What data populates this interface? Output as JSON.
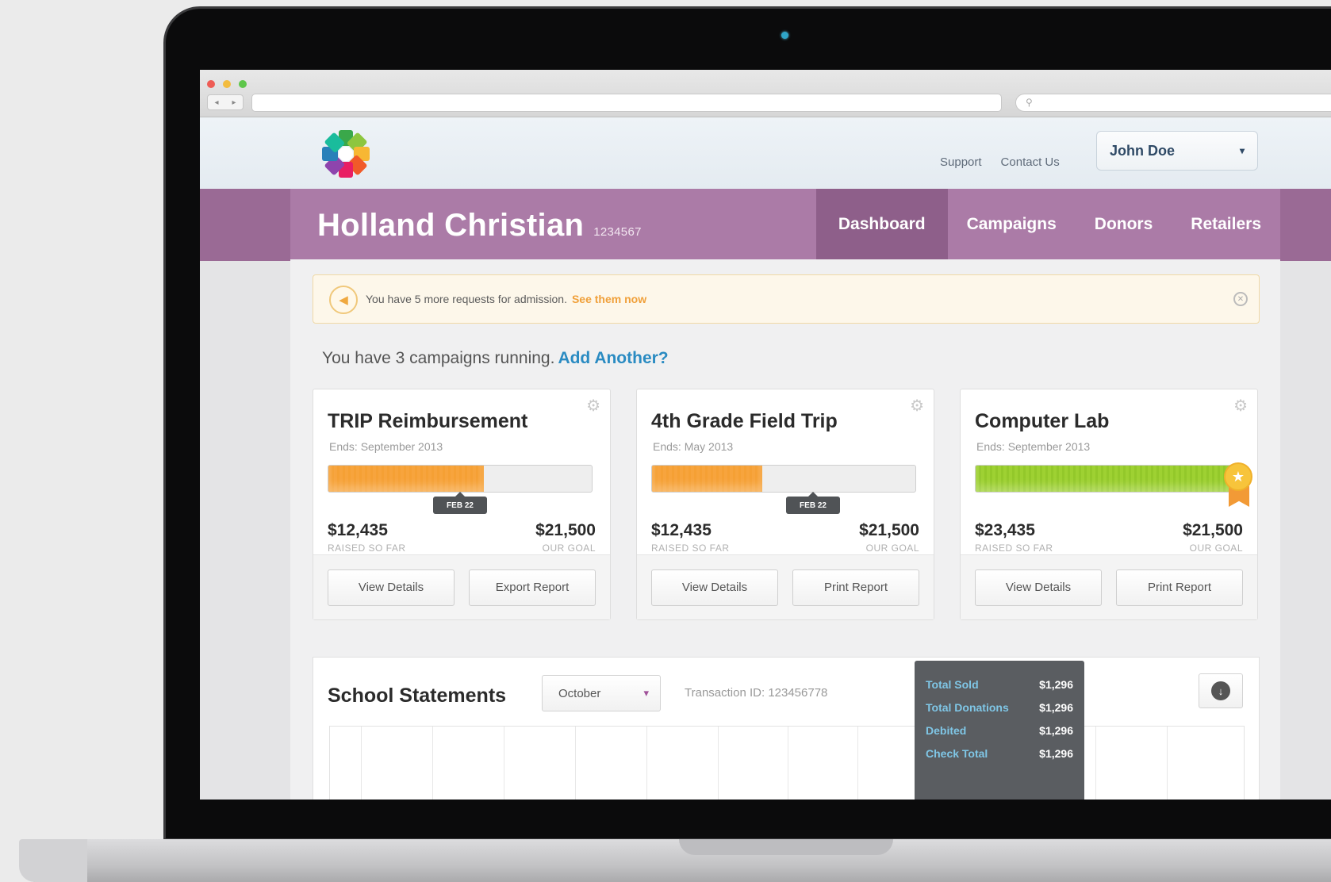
{
  "browser": {
    "url": "",
    "search_placeholder": "⚲"
  },
  "header": {
    "links": [
      "Support",
      "Contact Us"
    ],
    "user_name": "John Doe"
  },
  "org": {
    "name": "Holland Christian",
    "id": "1234567"
  },
  "tabs": [
    "Dashboard",
    "Campaigns",
    "Donors",
    "Retailers"
  ],
  "alert": {
    "text": "You have 5 more requests for admission.",
    "link": "See them now"
  },
  "summary": {
    "text": "You have 3 campaigns running.",
    "link": "Add Another?"
  },
  "campaigns": [
    {
      "title": "TRIP Reimbursement",
      "ends": "Ends: September 2013",
      "progress": 0.59,
      "bar_color": "#f7a43d",
      "date_tag": "FEB 22",
      "raised": "$12,435",
      "raised_label": "RAISED SO FAR",
      "goal": "$21,500",
      "goal_label": "OUR GOAL",
      "buttons": [
        "View Details",
        "Export Report"
      ]
    },
    {
      "title": "4th Grade Field Trip",
      "ends": "Ends: May 2013",
      "progress": 0.42,
      "bar_color": "#f7a43d",
      "date_tag": "FEB 22",
      "raised": "$12,435",
      "raised_label": "RAISED SO FAR",
      "goal": "$21,500",
      "goal_label": "OUR GOAL",
      "buttons": [
        "View Details",
        "Print Report"
      ]
    },
    {
      "title": "Computer Lab",
      "ends": "Ends: September 2013",
      "progress": 1.0,
      "bar_color": "#9ed132",
      "raised": "$23,435",
      "raised_label": "RAISED SO FAR",
      "goal": "$21,500",
      "goal_label": "OUR GOAL",
      "buttons": [
        "View Details",
        "Print Report"
      ]
    }
  ],
  "statements": {
    "title": "School Statements",
    "month": "October",
    "transaction": "Transaction ID: 123456778",
    "totals": [
      {
        "label": "Total Sold",
        "value": "$1,296"
      },
      {
        "label": "Total Donations",
        "value": "$1,296"
      },
      {
        "label": "Debited",
        "value": "$1,296"
      },
      {
        "label": "Check Total",
        "value": "$1,296"
      }
    ]
  },
  "icons": {
    "alert": "megaphone-icon",
    "close": "close-icon",
    "settings": "gear-icon",
    "award": "star-badge-icon",
    "download": "download-icon"
  },
  "colors": {
    "brand_purple": "#ab7ba7",
    "active_tab": "#8e5f8a",
    "link_blue": "#2a8bc2",
    "alert_orange": "#f0a03a",
    "totals_label": "#7fc6e6"
  }
}
